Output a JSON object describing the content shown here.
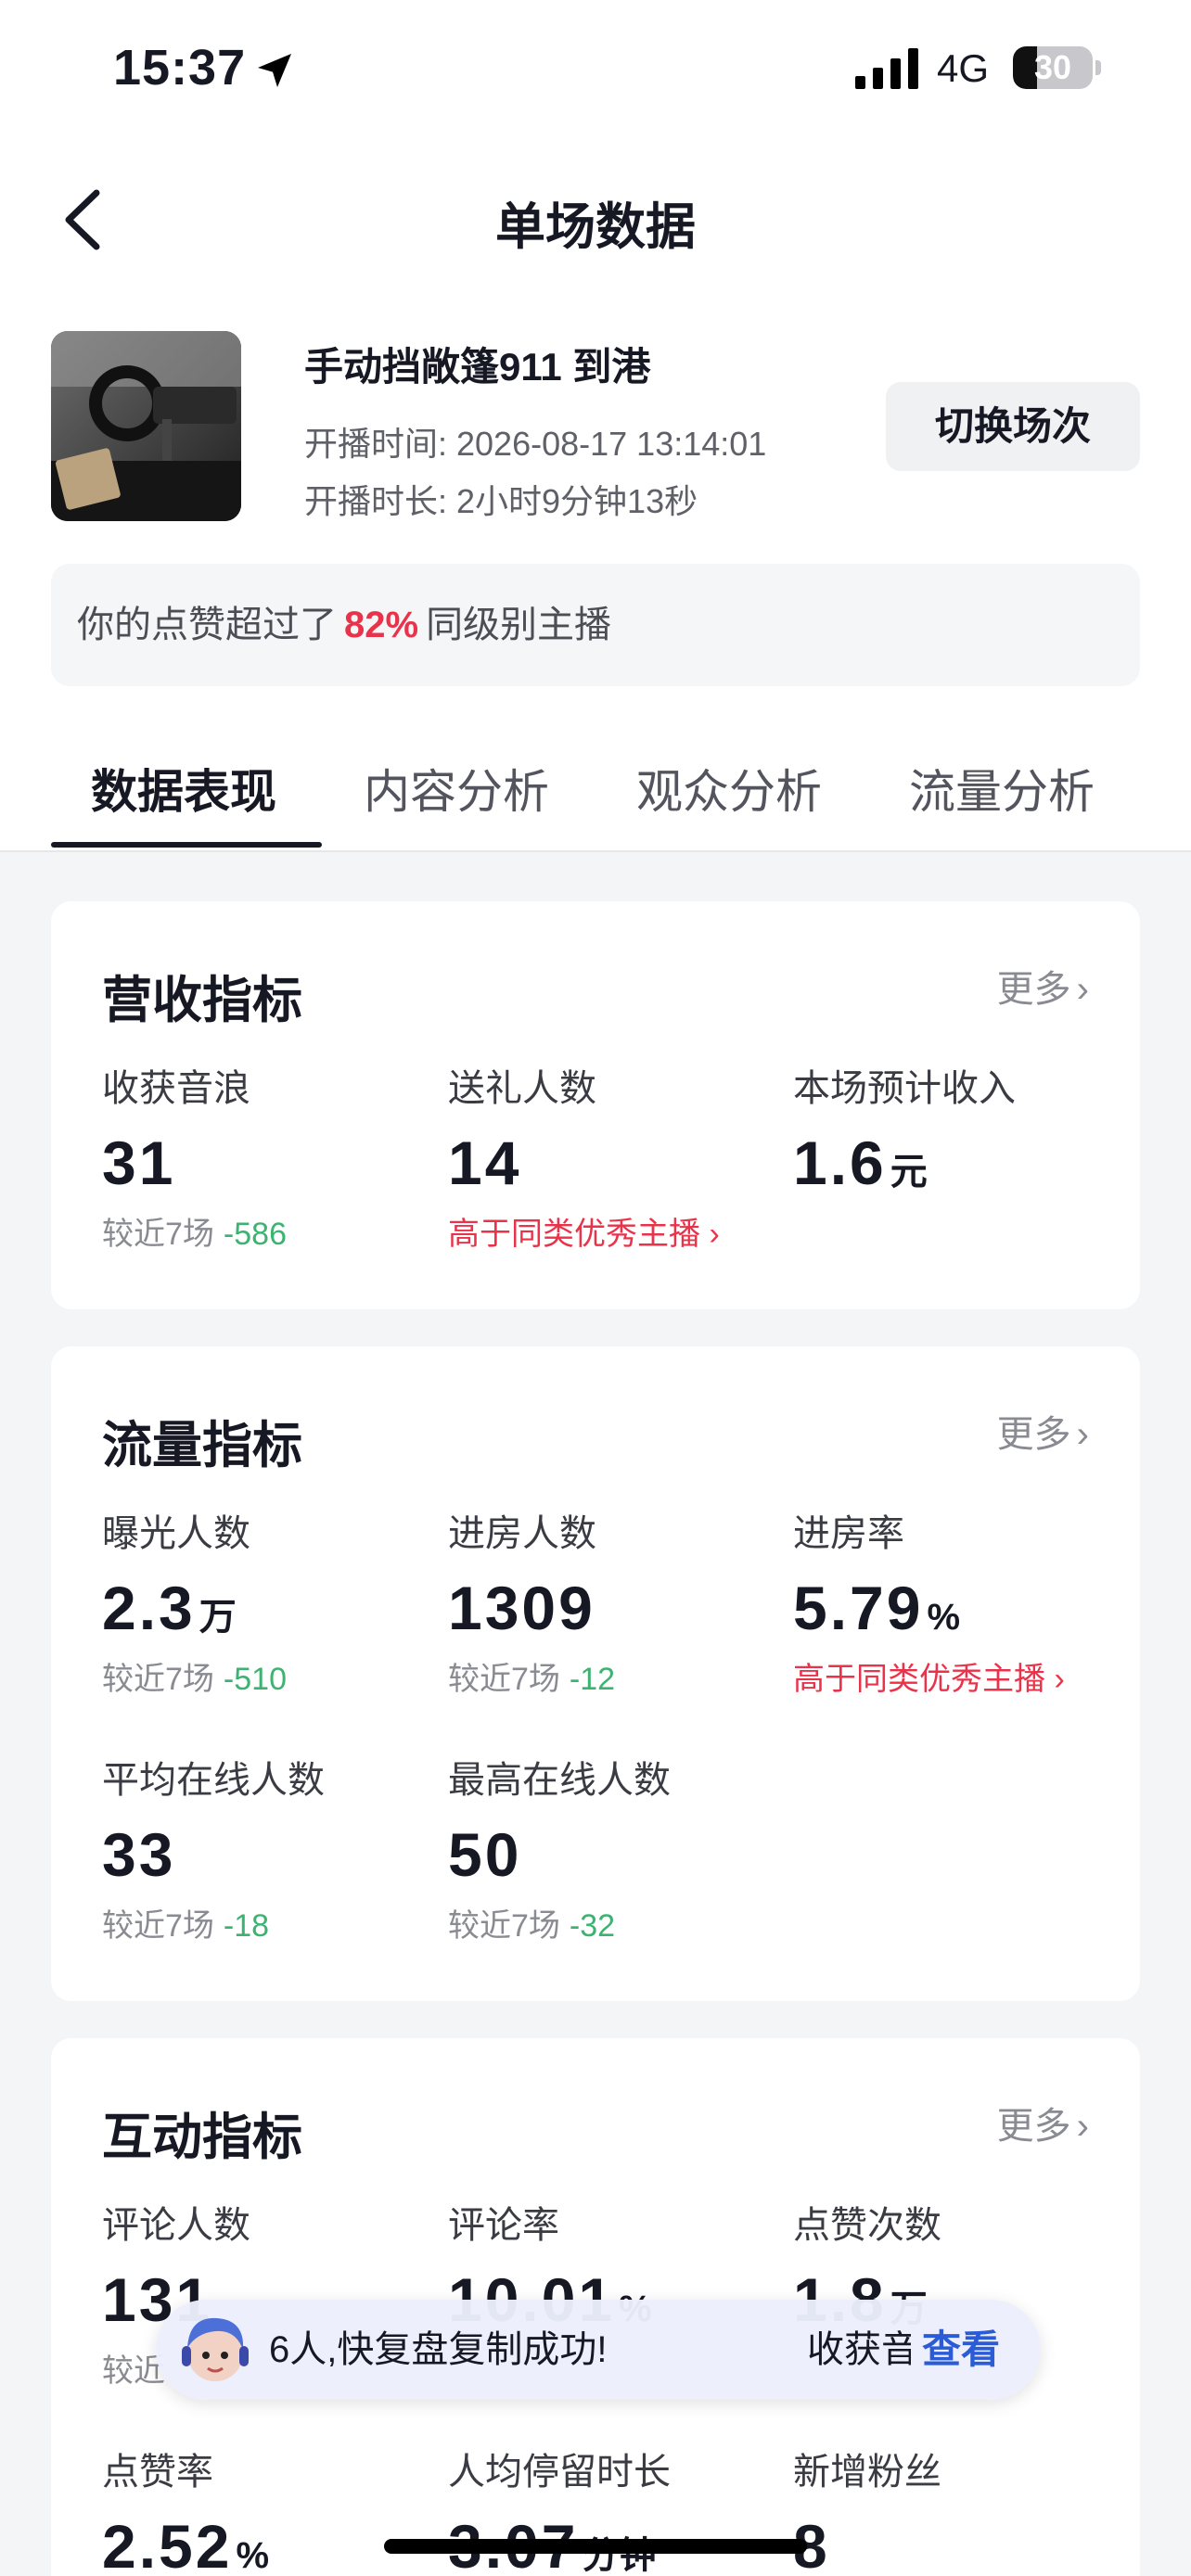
{
  "status_bar": {
    "time": "15:37",
    "network": "4G",
    "battery": "30",
    "battery_level": 0.3
  },
  "nav": {
    "title": "单场数据"
  },
  "session": {
    "title": "手动挡敞篷911 到港",
    "start_label": "开播时间:",
    "start_value": "2026-08-17 13:14:01",
    "duration_label": "开播时长:",
    "duration_value": "2小时9分钟13秒",
    "switch_label": "切换场次"
  },
  "praise": {
    "prefix": "你的点赞超过了",
    "percent": "82%",
    "suffix": "同级别主播"
  },
  "tabs": [
    {
      "label": "数据表现",
      "active": true
    },
    {
      "label": "内容分析",
      "active": false
    },
    {
      "label": "观众分析",
      "active": false
    },
    {
      "label": "流量分析",
      "active": false
    }
  ],
  "revenue": {
    "title": "营收指标",
    "more": "更多",
    "metrics": [
      {
        "label": "收获音浪",
        "value": "31",
        "unit": "",
        "compare": "较近7场",
        "delta": "-586"
      },
      {
        "label": "送礼人数",
        "value": "14",
        "unit": "",
        "hint": "高于同类优秀主播"
      },
      {
        "label": "本场预计收入",
        "value": "1.6",
        "unit": "元"
      }
    ]
  },
  "traffic": {
    "title": "流量指标",
    "more": "更多",
    "metrics": [
      {
        "label": "曝光人数",
        "value": "2.3",
        "unit": "万",
        "compare": "较近7场",
        "delta": "-510"
      },
      {
        "label": "进房人数",
        "value": "1309",
        "unit": "",
        "compare": "较近7场",
        "delta": "-12"
      },
      {
        "label": "进房率",
        "value": "5.79",
        "unit": "%",
        "hint": "高于同类优秀主播"
      },
      {
        "label": "平均在线人数",
        "value": "33",
        "unit": "",
        "compare": "较近7场",
        "delta": "-18"
      },
      {
        "label": "最高在线人数",
        "value": "50",
        "unit": "",
        "compare": "较近7场",
        "delta": "-32"
      }
    ]
  },
  "interaction": {
    "title": "互动指标",
    "more": "更多",
    "metrics": [
      {
        "label": "评论人数",
        "value": "131",
        "unit": "",
        "compare": "较近"
      },
      {
        "label": "评论率",
        "value": "10.01",
        "unit": "%"
      },
      {
        "label": "点赞次数",
        "value": "1.8",
        "unit": "万"
      },
      {
        "label": "点赞率",
        "value": "2.52",
        "unit": "%"
      },
      {
        "label": "人均停留时长",
        "value": "3.07",
        "unit": "分钟"
      },
      {
        "label": "新增粉丝",
        "value": "8",
        "unit": ""
      }
    ]
  },
  "toast": {
    "text": "6人,快复盘复制成功!",
    "secondary": "收获音",
    "action": "查看"
  },
  "colors": {
    "accent_red": "#e8334a",
    "delta_green": "#3cb371",
    "link_blue": "#2c5bd6"
  }
}
